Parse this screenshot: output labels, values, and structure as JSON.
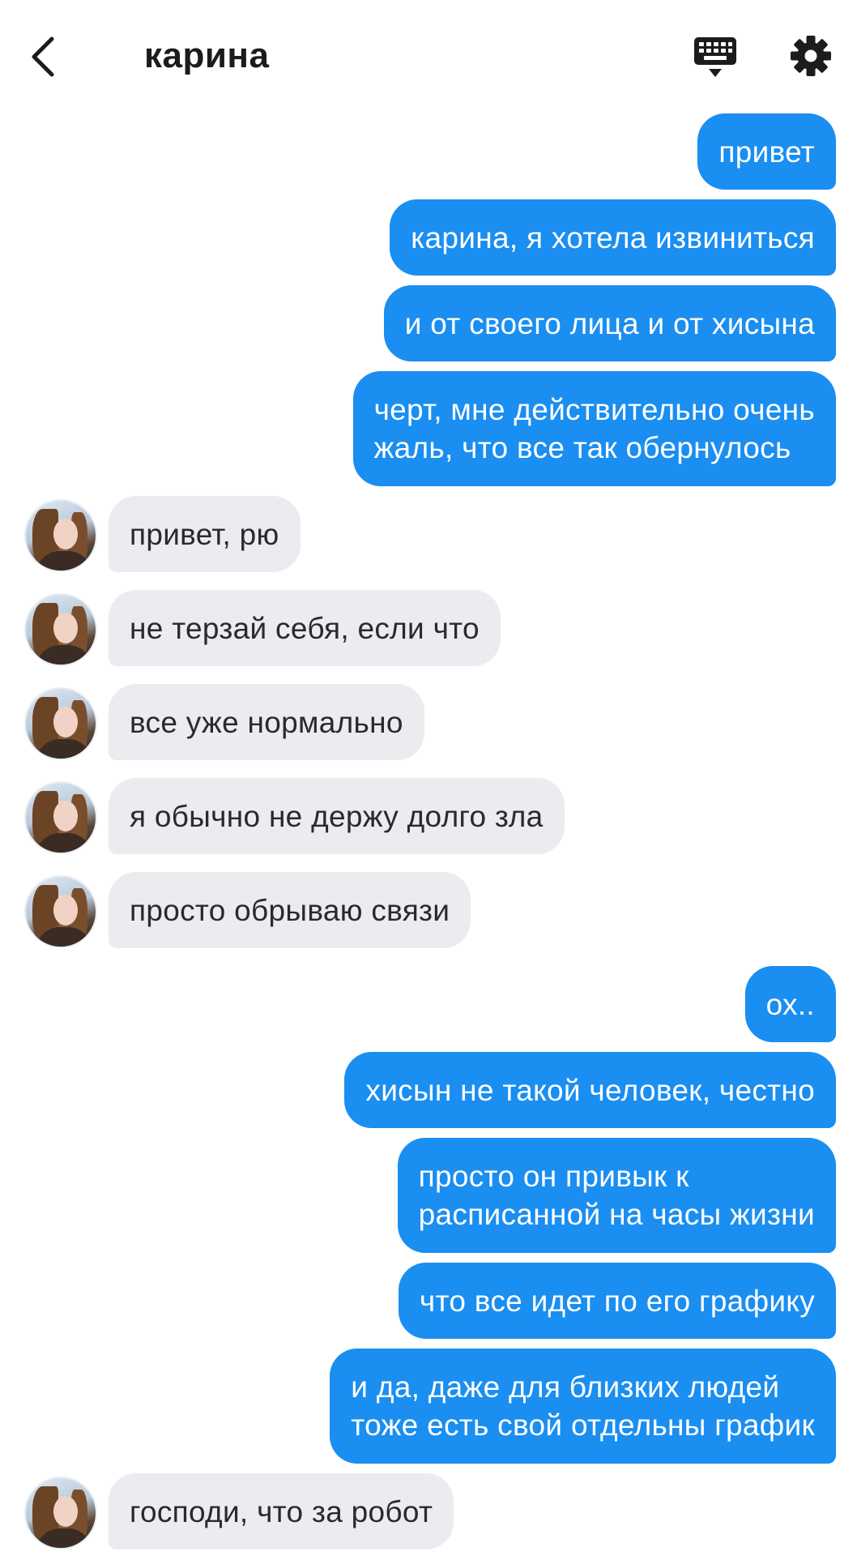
{
  "header": {
    "title": "карина",
    "back_icon": "chevron-left-icon",
    "keyboard_icon": "keyboard-hide-icon",
    "settings_icon": "gear-icon"
  },
  "colors": {
    "outgoing_bubble": "#1a8ef1",
    "incoming_bubble": "#ebebf0",
    "outgoing_text": "#ffffff",
    "incoming_text": "#2a2a2c"
  },
  "messages": [
    {
      "dir": "out",
      "lines": [
        "привет"
      ]
    },
    {
      "dir": "out",
      "lines": [
        "карина, я хотела извиниться"
      ]
    },
    {
      "dir": "out",
      "lines": [
        "и от своего лица и от хисына"
      ]
    },
    {
      "dir": "out",
      "lines": [
        "черт, мне действительно очень",
        "жаль, что все так обернулось"
      ]
    },
    {
      "dir": "in",
      "lines": [
        "привет, рю"
      ]
    },
    {
      "dir": "in",
      "lines": [
        "не терзай себя, если что"
      ]
    },
    {
      "dir": "in",
      "lines": [
        "все уже нормально"
      ]
    },
    {
      "dir": "in",
      "lines": [
        "я обычно не держу долго зла"
      ]
    },
    {
      "dir": "in",
      "lines": [
        "просто обрываю связи"
      ]
    },
    {
      "dir": "out",
      "lines": [
        "ох.."
      ]
    },
    {
      "dir": "out",
      "lines": [
        "хисын не такой человек, честно"
      ]
    },
    {
      "dir": "out",
      "lines": [
        "просто он привык к",
        "расписанной на часы жизни"
      ]
    },
    {
      "dir": "out",
      "lines": [
        "что все идет по его графику"
      ]
    },
    {
      "dir": "out",
      "lines": [
        "и да, даже для близких людей",
        "тоже есть свой отдельны график"
      ]
    },
    {
      "dir": "in",
      "lines": [
        "господи, что за робот"
      ]
    }
  ]
}
